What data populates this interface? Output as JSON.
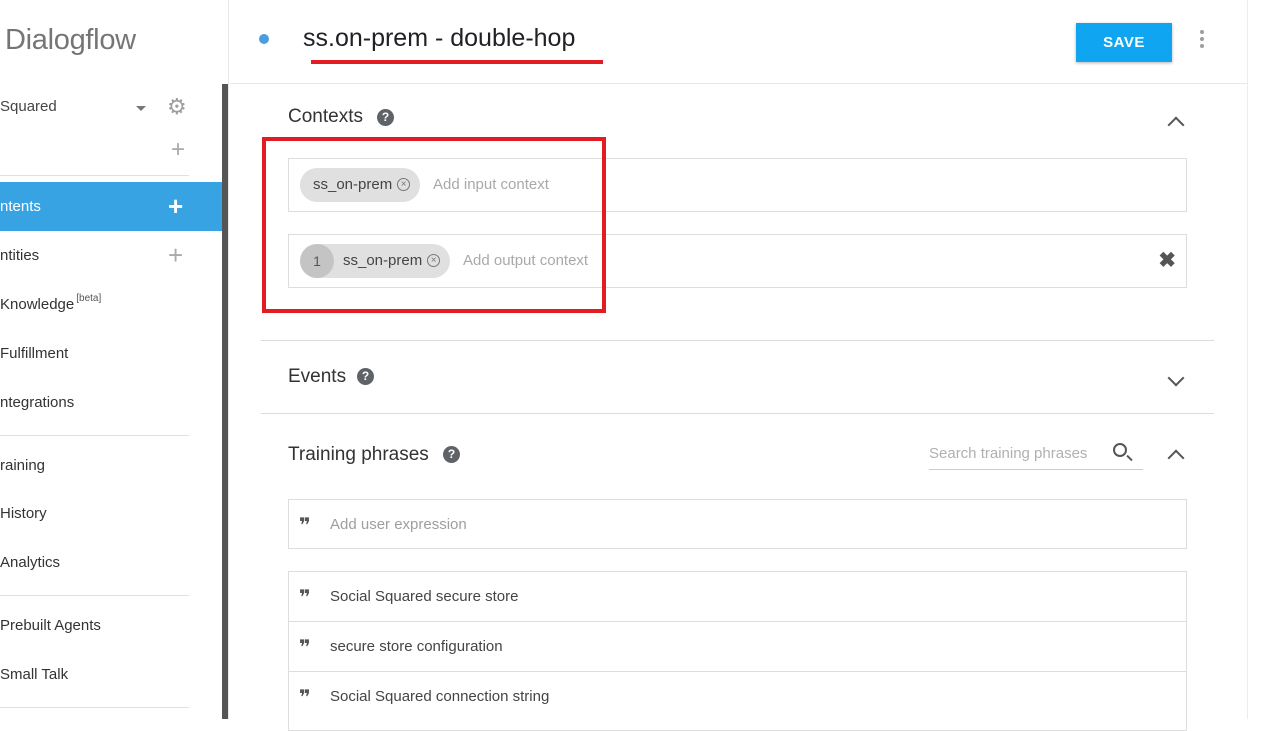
{
  "app": {
    "brand": "Dialogflow"
  },
  "agent": {
    "name": "Squared"
  },
  "sidebar": {
    "items": [
      {
        "label": "ntents",
        "active": true,
        "has_plus": true
      },
      {
        "label": "ntities",
        "has_plus": true
      },
      {
        "label": "Knowledge",
        "badge": "[beta]"
      },
      {
        "label": "Fulfillment"
      },
      {
        "label": "ntegrations"
      },
      {
        "label": "raining"
      },
      {
        "label": "History"
      },
      {
        "label": "Analytics"
      },
      {
        "label": "Prebuilt Agents"
      },
      {
        "label": "Small Talk"
      }
    ]
  },
  "header": {
    "intent_title": "ss.on-prem - double-hop",
    "save_label": "SAVE"
  },
  "contexts": {
    "title": "Contexts",
    "input_chip": "ss_on-prem",
    "input_placeholder": "Add input context",
    "output_lifespan": "1",
    "output_chip": "ss_on-prem",
    "output_placeholder": "Add output context"
  },
  "events": {
    "title": "Events"
  },
  "training": {
    "title": "Training phrases",
    "search_placeholder": "Search training phrases",
    "add_placeholder": "Add user expression",
    "phrases": [
      "Social Squared secure store",
      "secure store configuration",
      "Social Squared connection string"
    ]
  },
  "colors": {
    "accent": "#38a3e3",
    "save": "#0fa5f0",
    "highlight": "#e31b23"
  },
  "icons": [
    "settings-gear-icon",
    "plus-icon",
    "help-icon",
    "chevron-up-icon",
    "chevron-down-icon",
    "search-icon",
    "quote-icon",
    "clear-icon",
    "more-vert-icon"
  ]
}
